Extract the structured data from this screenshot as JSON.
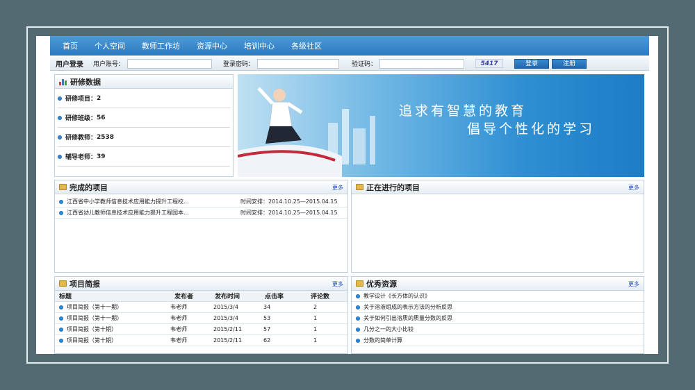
{
  "nav": [
    "首页",
    "个人空间",
    "教师工作坊",
    "资源中心",
    "培训中心",
    "各级社区"
  ],
  "login": {
    "title": "用户登录",
    "account_label": "用户账号：",
    "password_label": "登录密码：",
    "captcha_label": "验证码：",
    "captcha_text": "5417",
    "login_button": "登录",
    "register_button": "注册"
  },
  "stats": {
    "title": "研修数据",
    "items": [
      {
        "label": "研修项目：",
        "value": "2"
      },
      {
        "label": "研修班级：",
        "value": "56"
      },
      {
        "label": "研修教师：",
        "value": "2538"
      },
      {
        "label": "辅导老师：",
        "value": "39"
      }
    ]
  },
  "banner": {
    "line1": "追求有智慧的教育",
    "line2": "倡导个性化的学习"
  },
  "completed": {
    "title": "完成的项目",
    "more": "更多",
    "items": [
      {
        "name": "江西省中小学教师信息技术应用能力提升工程校...",
        "time": "时间安排：2014.10.25—2015.04.15"
      },
      {
        "name": "江西省幼儿教师信息技术应用能力提升工程园本...",
        "time": "时间安排：2014.10.25—2015.04.15"
      }
    ]
  },
  "ongoing": {
    "title": "正在进行的项目",
    "more": "更多"
  },
  "briefing": {
    "title": "项目简报",
    "more": "更多",
    "columns": [
      "标题",
      "发布者",
      "发布时间",
      "点击率",
      "评论数"
    ],
    "rows": [
      {
        "title": "项目简报（第十一期）",
        "author": "韦老师",
        "date": "2015/3/4",
        "clicks": "34",
        "comments": "2"
      },
      {
        "title": "项目简报（第十一期）",
        "author": "韦老师",
        "date": "2015/3/4",
        "clicks": "53",
        "comments": "1"
      },
      {
        "title": "项目简报（第十期）",
        "author": "韦老师",
        "date": "2015/2/11",
        "clicks": "57",
        "comments": "1"
      },
      {
        "title": "项目简报（第十期）",
        "author": "韦老师",
        "date": "2015/2/11",
        "clicks": "62",
        "comments": "1"
      }
    ]
  },
  "resources": {
    "title": "优秀资源",
    "more": "更多",
    "items": [
      "教学设计《长方体的认识》",
      "关于溶液组成的表示方法的分析反思",
      "关于如何引出溶质的质量分数的反思",
      "几分之一的大小比较",
      "分数的简单计算"
    ]
  }
}
